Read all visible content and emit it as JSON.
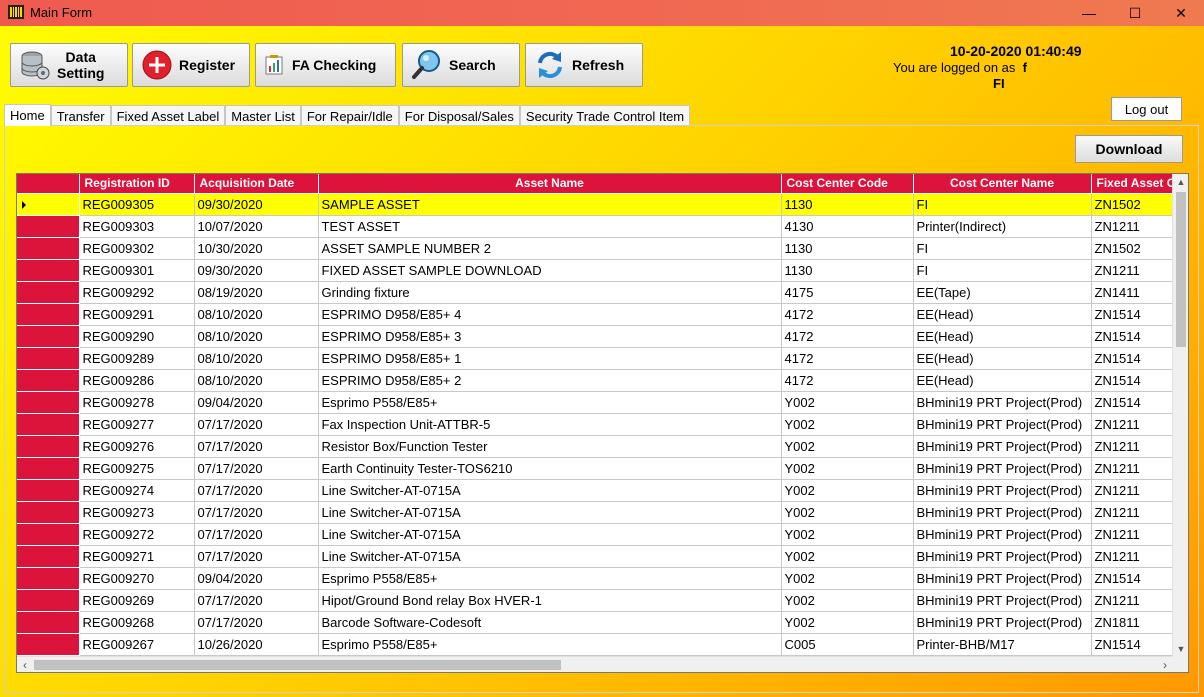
{
  "window": {
    "title": "Main Form",
    "controls": {
      "minimize": "—",
      "maximize": "☐",
      "close": "✕"
    }
  },
  "toolbar": {
    "data_setting_line1": "Data",
    "data_setting_line2": "Setting",
    "register": "Register",
    "fa_checking": "FA Checking",
    "search": "Search",
    "refresh": "Refresh"
  },
  "session": {
    "datetime": "10-20-2020 01:40:49",
    "logged_on_prefix": "You are logged on as",
    "user": "f",
    "department": "FI",
    "logout": "Log out"
  },
  "tabs": [
    "Home",
    "Transfer",
    "Fixed Asset Label",
    "Master List",
    "For Repair/Idle",
    "For Disposal/Sales",
    "Security Trade Control Item"
  ],
  "active_tab": "Home",
  "download_label": "Download",
  "grid": {
    "columns": [
      "Registration ID",
      "Acquisition Date",
      "Asset Name",
      "Cost Center Code",
      "Cost Center Name",
      "Fixed Asset C"
    ],
    "selected_row": 0,
    "rows": [
      [
        "REG009305",
        "09/30/2020",
        "SAMPLE ASSET",
        "1130",
        "FI",
        "ZN1502"
      ],
      [
        "REG009303",
        "10/07/2020",
        "TEST ASSET",
        "4130",
        "Printer(Indirect)",
        "ZN1211"
      ],
      [
        "REG009302",
        "10/30/2020",
        "ASSET SAMPLE NUMBER 2",
        "1130",
        "FI",
        "ZN1502"
      ],
      [
        "REG009301",
        "09/30/2020",
        "FIXED ASSET SAMPLE DOWNLOAD",
        "1130",
        "FI",
        "ZN1211"
      ],
      [
        "REG009292",
        "08/19/2020",
        "Grinding fixture",
        "4175",
        "EE(Tape)",
        "ZN1411"
      ],
      [
        "REG009291",
        "08/10/2020",
        "ESPRIMO D958/E85+ 4",
        "4172",
        "EE(Head)",
        "ZN1514"
      ],
      [
        "REG009290",
        "08/10/2020",
        "ESPRIMO D958/E85+ 3",
        "4172",
        "EE(Head)",
        "ZN1514"
      ],
      [
        "REG009289",
        "08/10/2020",
        "ESPRIMO D958/E85+ 1",
        "4172",
        "EE(Head)",
        "ZN1514"
      ],
      [
        "REG009286",
        "08/10/2020",
        "ESPRIMO D958/E85+ 2",
        "4172",
        "EE(Head)",
        "ZN1514"
      ],
      [
        "REG009278",
        "09/04/2020",
        "Esprimo P558/E85+",
        "Y002",
        "BHmini19 PRT Project(Prod)",
        "ZN1514"
      ],
      [
        "REG009277",
        "07/17/2020",
        "Fax Inspection Unit-ATTBR-5",
        "Y002",
        "BHmini19 PRT Project(Prod)",
        "ZN1211"
      ],
      [
        "REG009276",
        "07/17/2020",
        "Resistor Box/Function Tester",
        "Y002",
        "BHmini19 PRT Project(Prod)",
        "ZN1211"
      ],
      [
        "REG009275",
        "07/17/2020",
        "Earth Continuity Tester-TOS6210",
        "Y002",
        "BHmini19 PRT Project(Prod)",
        "ZN1211"
      ],
      [
        "REG009274",
        "07/17/2020",
        "Line Switcher-AT-0715A",
        "Y002",
        "BHmini19 PRT Project(Prod)",
        "ZN1211"
      ],
      [
        "REG009273",
        "07/17/2020",
        "Line Switcher-AT-0715A",
        "Y002",
        "BHmini19 PRT Project(Prod)",
        "ZN1211"
      ],
      [
        "REG009272",
        "07/17/2020",
        "Line Switcher-AT-0715A",
        "Y002",
        "BHmini19 PRT Project(Prod)",
        "ZN1211"
      ],
      [
        "REG009271",
        "07/17/2020",
        "Line Switcher-AT-0715A",
        "Y002",
        "BHmini19 PRT Project(Prod)",
        "ZN1211"
      ],
      [
        "REG009270",
        "09/04/2020",
        "Esprimo P558/E85+",
        "Y002",
        "BHmini19 PRT Project(Prod)",
        "ZN1514"
      ],
      [
        "REG009269",
        "07/17/2020",
        "Hipot/Ground Bond relay Box HVER-1",
        "Y002",
        "BHmini19 PRT Project(Prod)",
        "ZN1211"
      ],
      [
        "REG009268",
        "07/17/2020",
        "Barcode Software-Codesoft",
        "Y002",
        "BHmini19 PRT Project(Prod)",
        "ZN1811"
      ],
      [
        "REG009267",
        "10/26/2020",
        "Esprimo P558/E85+",
        "C005",
        "Printer-BHB/M17",
        "ZN1514"
      ]
    ]
  },
  "colors": {
    "header_red": "#dc143c",
    "selection_yellow": "#ffff00",
    "titlebar": "#ef5a50"
  },
  "icons": {
    "app": "barcode-icon",
    "data_setting": "database-gear-icon",
    "register": "plus-circle-icon",
    "fa_checking": "chart-clipboard-icon",
    "search": "magnifier-icon",
    "refresh": "refresh-arrows-icon"
  }
}
